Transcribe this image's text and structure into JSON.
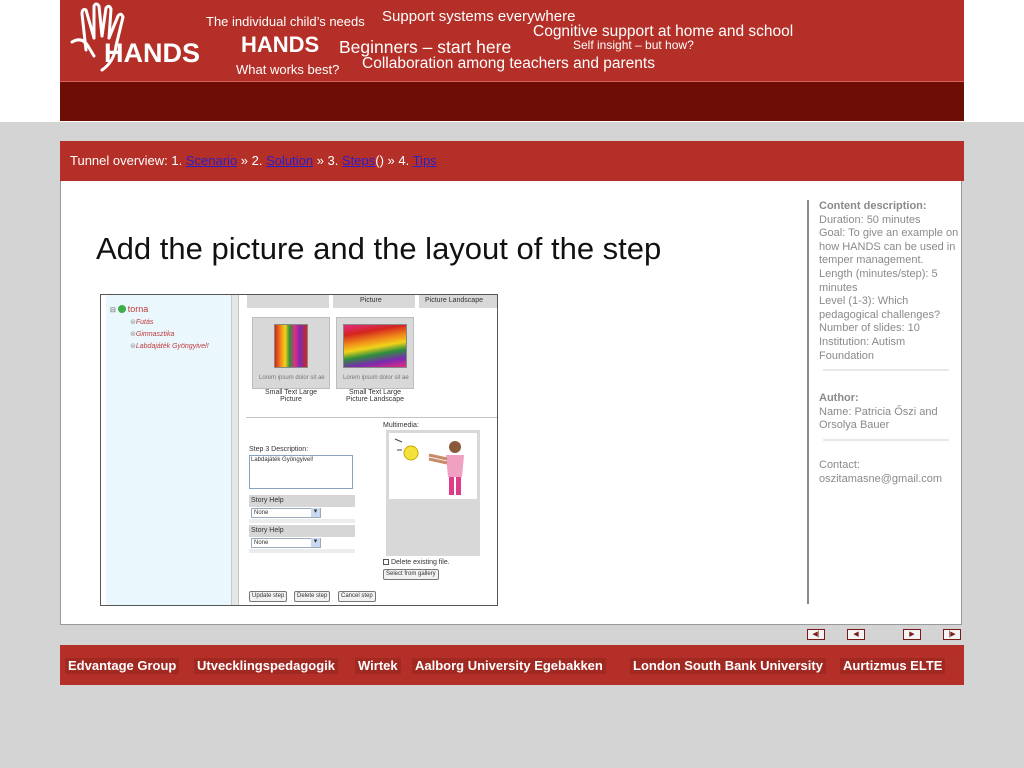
{
  "header": {
    "logo_text": "HANDS",
    "tagline_1": "The individual child’s needs",
    "tagline_2": "Support systems everywhere",
    "tagline_3": "Cognitive support at home and school",
    "tagline_4": "HANDS",
    "tagline_5": "Beginners – start here",
    "tagline_6": "Self insight – but how?",
    "tagline_7": "What works best?",
    "tagline_8": "Collaboration among teachers and parents"
  },
  "tunnel": {
    "prefix": "Tunnel overview:  1. ",
    "step1": "Scenario",
    "sep1": "  »  2. ",
    "step2": "Solution",
    "sep2": "  »  3. ",
    "step3": "Steps",
    "step3_suffix": "()  »  4. ",
    "step4": "Tips"
  },
  "slide": {
    "title": "Add the picture and the layout of the step"
  },
  "screenshot": {
    "tree": {
      "root": "torna",
      "items": [
        "Futás",
        "Gimnasztika",
        "Labdajáték Gyöngyivel!"
      ]
    },
    "top_captions": [
      "Picture",
      "Picture Landscape"
    ],
    "templates": [
      {
        "caption": "Lorem ipsum dolor sit ae",
        "name_line1": "Small Text Large",
        "name_line2": "Picture"
      },
      {
        "caption": "Lorem ipsum dolor sit ae",
        "name_line1": "Small Text Large",
        "name_line2": "Picture Landscape"
      }
    ],
    "step_desc_label": "Step 3 Description:",
    "step_desc_value": "Labdajáték Gyöngyivel!",
    "multimedia_label": "Multimedia:",
    "story_help_1": "Story Help",
    "story_help_2": "Story Help",
    "select_value_1": "None",
    "select_value_2": "None",
    "delete_file_label": "Delete existing file.",
    "select_gallery_button": "Select from gallery",
    "buttons": [
      "Update step",
      "Delete step",
      "Cancel step"
    ]
  },
  "sidebar": {
    "content_heading": "Content  description:",
    "content_lines": [
      "Duration: 50 minutes",
      "Goal: To give an example on how HANDS can  be used in temper management.",
      "Length (minutes/step): 5 minutes",
      "Level (1-3): Which pedagogical  challenges?",
      "Number of slides: 10",
      "Institution: Autism Foundation"
    ],
    "author_heading": "Author:",
    "author_line": "Name: Patricia Őszi  and Orsolya  Bauer",
    "contact_label": "Contact:",
    "contact_email": "oszitamasne@gmail.com"
  },
  "nav": {
    "first_icon": "first-slide-icon",
    "prev_icon": "previous-slide-icon",
    "next_icon": "next-slide-icon",
    "last_icon": "last-slide-icon"
  },
  "footer": {
    "partners": [
      "Edvantage Group",
      "Utvecklingspedagogik",
      "Wirtek",
      "Aalborg University Egebakken",
      "London South Bank University",
      "Aurtizmus ELTE"
    ]
  },
  "colors": {
    "header_red": "#b42f27",
    "header_dark": "#6e0d06",
    "link_blue": "#2a20c8",
    "sidebar_gray": "#8a8a8a"
  }
}
